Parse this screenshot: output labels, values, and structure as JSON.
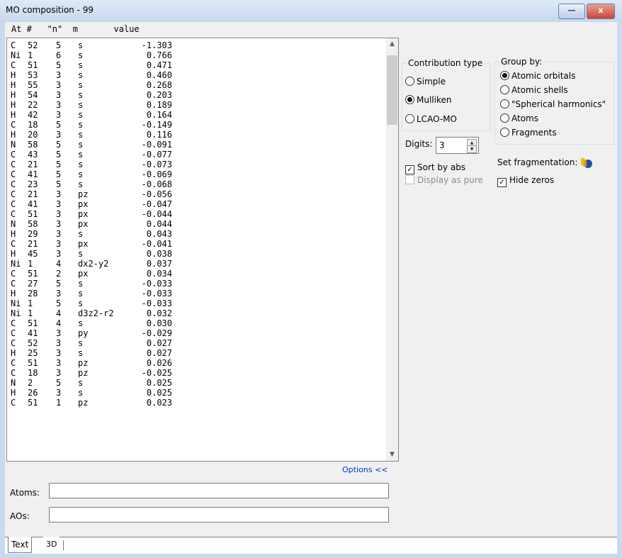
{
  "window": {
    "title": "MO composition - 99",
    "minimize_glyph": "—",
    "close_glyph": "x"
  },
  "columns": {
    "header": "At #   \"n\"  m       value"
  },
  "rows": [
    {
      "at": "C",
      "num": "52",
      "n": "5",
      "m": "s",
      "value": "-1.303"
    },
    {
      "at": "Ni",
      "num": "1",
      "n": "6",
      "m": "s",
      "value": "0.766"
    },
    {
      "at": "C",
      "num": "51",
      "n": "5",
      "m": "s",
      "value": "0.471"
    },
    {
      "at": "H",
      "num": "53",
      "n": "3",
      "m": "s",
      "value": "0.460"
    },
    {
      "at": "H",
      "num": "55",
      "n": "3",
      "m": "s",
      "value": "0.268"
    },
    {
      "at": "H",
      "num": "54",
      "n": "3",
      "m": "s",
      "value": "0.203"
    },
    {
      "at": "H",
      "num": "22",
      "n": "3",
      "m": "s",
      "value": "0.189"
    },
    {
      "at": "H",
      "num": "42",
      "n": "3",
      "m": "s",
      "value": "0.164"
    },
    {
      "at": "C",
      "num": "18",
      "n": "5",
      "m": "s",
      "value": "-0.149"
    },
    {
      "at": "H",
      "num": "20",
      "n": "3",
      "m": "s",
      "value": "0.116"
    },
    {
      "at": "N",
      "num": "58",
      "n": "5",
      "m": "s",
      "value": "-0.091"
    },
    {
      "at": "C",
      "num": "43",
      "n": "5",
      "m": "s",
      "value": "-0.077"
    },
    {
      "at": "C",
      "num": "21",
      "n": "5",
      "m": "s",
      "value": "-0.073"
    },
    {
      "at": "C",
      "num": "41",
      "n": "5",
      "m": "s",
      "value": "-0.069"
    },
    {
      "at": "C",
      "num": "23",
      "n": "5",
      "m": "s",
      "value": "-0.068"
    },
    {
      "at": "C",
      "num": "21",
      "n": "3",
      "m": "pz",
      "value": "-0.056"
    },
    {
      "at": "C",
      "num": "41",
      "n": "3",
      "m": "px",
      "value": "-0.047"
    },
    {
      "at": "C",
      "num": "51",
      "n": "3",
      "m": "px",
      "value": "-0.044"
    },
    {
      "at": "N",
      "num": "58",
      "n": "3",
      "m": "px",
      "value": "0.044"
    },
    {
      "at": "H",
      "num": "29",
      "n": "3",
      "m": "s",
      "value": "0.043"
    },
    {
      "at": "C",
      "num": "21",
      "n": "3",
      "m": "px",
      "value": "-0.041"
    },
    {
      "at": "H",
      "num": "45",
      "n": "3",
      "m": "s",
      "value": "0.038"
    },
    {
      "at": "Ni",
      "num": "1",
      "n": "4",
      "m": "dx2-y2",
      "value": "0.037"
    },
    {
      "at": "C",
      "num": "51",
      "n": "2",
      "m": "px",
      "value": "0.034"
    },
    {
      "at": "C",
      "num": "27",
      "n": "5",
      "m": "s",
      "value": "-0.033"
    },
    {
      "at": "H",
      "num": "28",
      "n": "3",
      "m": "s",
      "value": "-0.033"
    },
    {
      "at": "Ni",
      "num": "1",
      "n": "5",
      "m": "s",
      "value": "-0.033"
    },
    {
      "at": "Ni",
      "num": "1",
      "n": "4",
      "m": "d3z2-r2",
      "value": "0.032"
    },
    {
      "at": "C",
      "num": "51",
      "n": "4",
      "m": "s",
      "value": "0.030"
    },
    {
      "at": "C",
      "num": "41",
      "n": "3",
      "m": "py",
      "value": "-0.029"
    },
    {
      "at": "C",
      "num": "52",
      "n": "3",
      "m": "s",
      "value": "0.027"
    },
    {
      "at": "H",
      "num": "25",
      "n": "3",
      "m": "s",
      "value": "0.027"
    },
    {
      "at": "C",
      "num": "51",
      "n": "3",
      "m": "pz",
      "value": "0.026"
    },
    {
      "at": "C",
      "num": "18",
      "n": "3",
      "m": "pz",
      "value": "-0.025"
    },
    {
      "at": "N",
      "num": "2",
      "n": "5",
      "m": "s",
      "value": "0.025"
    },
    {
      "at": "H",
      "num": "26",
      "n": "3",
      "m": "s",
      "value": "0.025"
    },
    {
      "at": "C",
      "num": "51",
      "n": "1",
      "m": "pz",
      "value": "0.023"
    }
  ],
  "scrollbar": {
    "up_icon": "up-arrow",
    "down_icon": "down-arrow",
    "up_glyph": "▲",
    "down_glyph": "▼"
  },
  "options_link": "Options <<",
  "fields": {
    "atoms_label": "Atoms:",
    "atoms_value": "",
    "aos_label": "AOs:",
    "aos_value": ""
  },
  "contribution": {
    "legend": "Contribution type",
    "options": [
      {
        "label": "Simple",
        "selected": false
      },
      {
        "label": "Mulliken",
        "selected": true
      },
      {
        "label": "LCAO-MO",
        "selected": false
      }
    ]
  },
  "group_by": {
    "legend": "Group by:",
    "options": [
      {
        "label": "Atomic orbitals",
        "selected": true
      },
      {
        "label": "Atomic shells",
        "selected": false
      },
      {
        "label": "\"Spherical harmonics\"",
        "selected": false
      },
      {
        "label": "Atoms",
        "selected": false
      },
      {
        "label": "Fragments",
        "selected": false
      }
    ]
  },
  "digits": {
    "label": "Digits:",
    "value": "3"
  },
  "sort_by_abs": {
    "label": "Sort by abs",
    "checked": true,
    "check_glyph": "✓"
  },
  "display_as_pure": {
    "label": "Display as pure",
    "checked": false,
    "enabled": false
  },
  "set_fragmentation": {
    "label": "Set fragmentation:",
    "icon": "fragmentation-icon"
  },
  "hide_zeros": {
    "label": "Hide zeros",
    "checked": true,
    "check_glyph": "✓"
  },
  "tabs": [
    {
      "label": "Text",
      "active": true
    },
    {
      "label": "3D",
      "active": false
    }
  ]
}
